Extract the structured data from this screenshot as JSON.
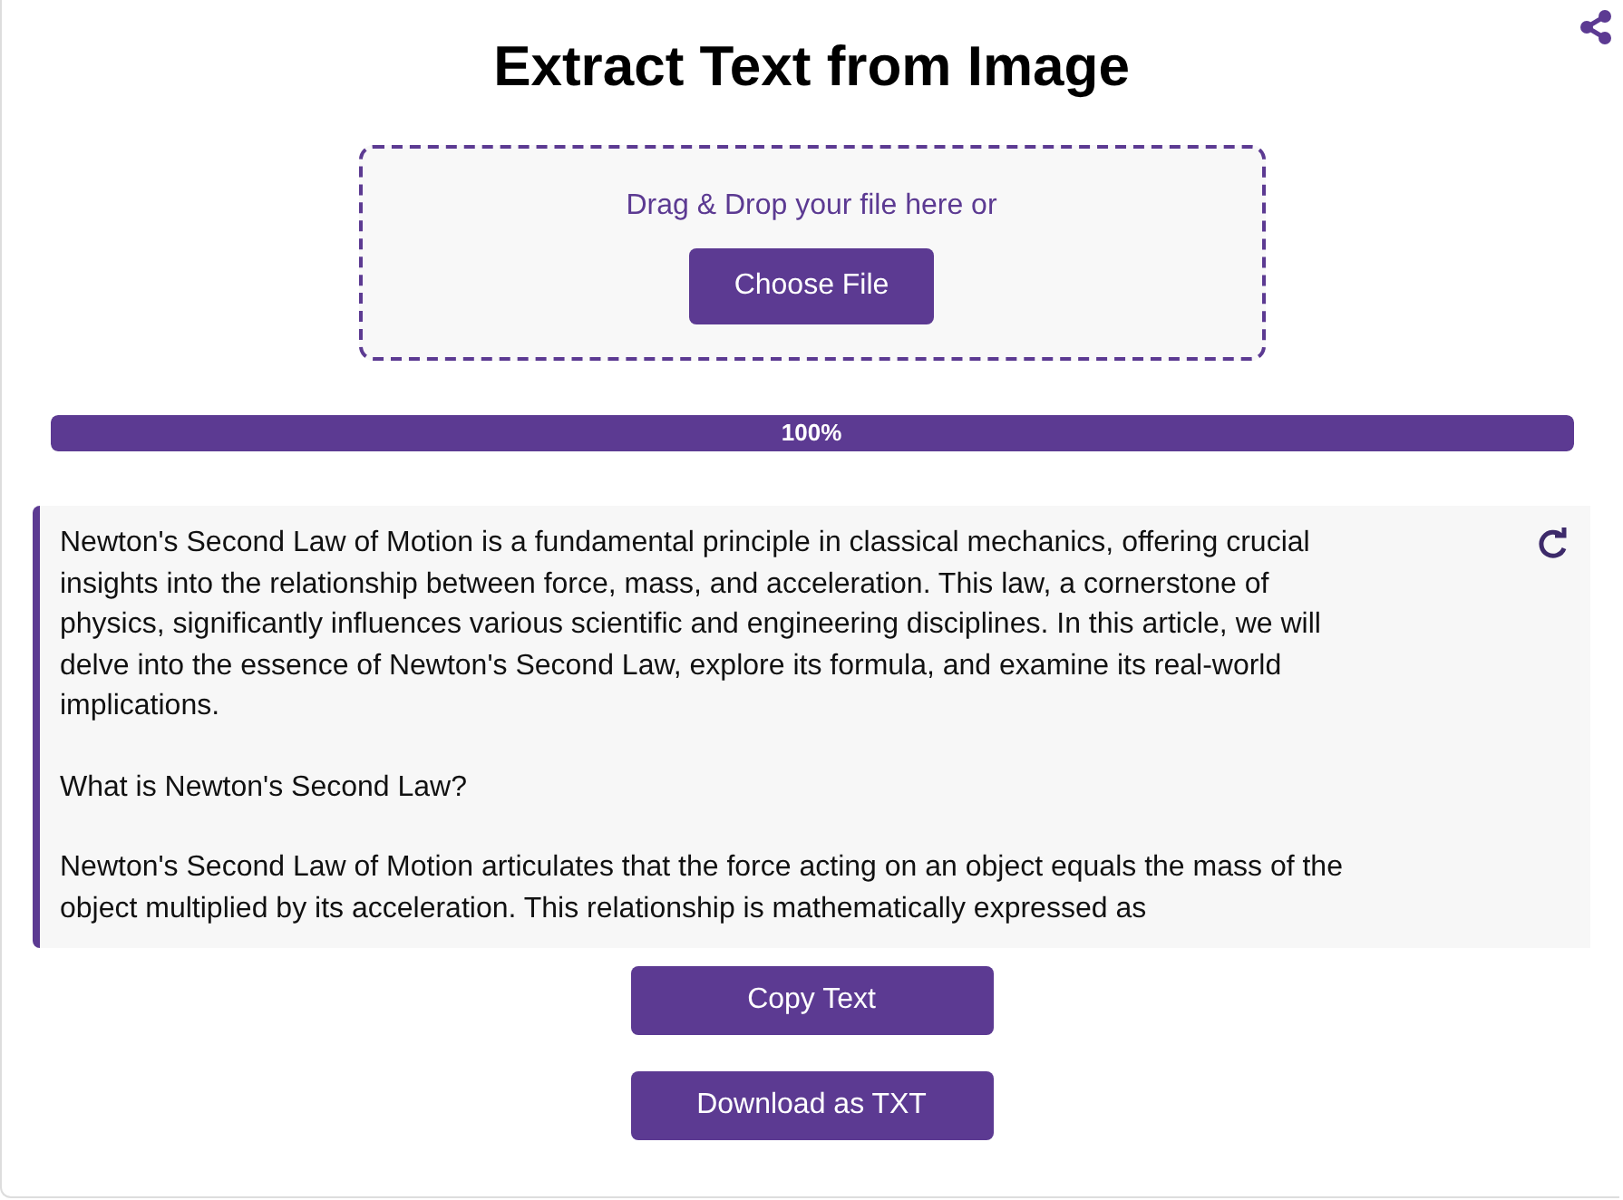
{
  "title": "Extract Text from Image",
  "dropzone": {
    "prompt": "Drag & Drop your file here or",
    "button": "Choose File"
  },
  "progress": {
    "level": 1,
    "label": "100%"
  },
  "result": {
    "paragraphs": [
      "Newton's Second Law of Motion is a fundamental principle in classical mechanics, offering crucial insights into the relationship between force, mass, and acceleration. This law, a cornerstone of physics, significantly influences various scientific and engineering disciplines. In this article, we will delve into the essence of Newton's Second Law, explore its formula, and examine its real-world implications.",
      "What is Newton's Second Law?",
      "Newton's Second Law of Motion articulates that the force acting on an object equals the mass of the object multiplied by its acceleration. This relationship is mathematically expressed as"
    ]
  },
  "buttons": [
    "Copy Text",
    "Download as TXT"
  ]
}
